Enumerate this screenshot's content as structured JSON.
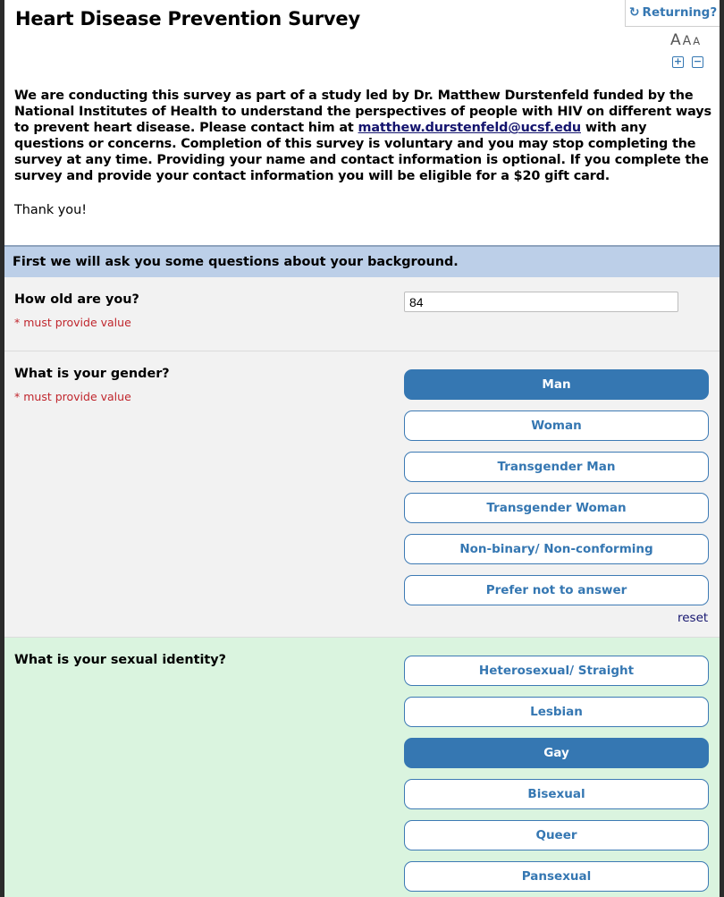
{
  "header": {
    "title": "Heart Disease Prevention Survey",
    "returning_label": "Returning?",
    "returning_icon": "refresh-icon",
    "font_size_labels": [
      "A",
      "A",
      "A"
    ],
    "zoom_in_icon": "plus-square-icon",
    "zoom_out_icon": "minus-square-icon"
  },
  "intro": {
    "text_before_link": "We are conducting this survey as part of a study led by Dr. Matthew Durstenfeld funded by the National Institutes of Health to understand the perspectives of people with HIV on different ways to prevent heart disease. Please contact him at ",
    "email_link": "matthew.durstenfeld@ucsf.edu",
    "text_after_link": " with any questions or concerns. Completion of this survey is voluntary and you may stop completing the survey at any time. Providing your name and contact information is optional. If you complete the survey and provide your contact information you will be eligible for a $20 gift card.",
    "thanks": "Thank you!"
  },
  "section": {
    "header": "First we will ask you some questions about your background."
  },
  "questions": {
    "age": {
      "label": "How old are you?",
      "required_note": "* must provide value",
      "value": "84"
    },
    "gender": {
      "label": "What is your gender?",
      "required_note": "* must provide value",
      "options": [
        {
          "label": "Man",
          "selected": true
        },
        {
          "label": "Woman",
          "selected": false
        },
        {
          "label": "Transgender Man",
          "selected": false
        },
        {
          "label": "Transgender Woman",
          "selected": false
        },
        {
          "label": "Non-binary/ Non-conforming",
          "selected": false
        },
        {
          "label": "Prefer not to answer",
          "selected": false
        }
      ],
      "reset_label": "reset"
    },
    "sexual_identity": {
      "label": "What is your sexual identity?",
      "options": [
        {
          "label": "Heterosexual/ Straight",
          "selected": false
        },
        {
          "label": "Lesbian",
          "selected": false
        },
        {
          "label": "Gay",
          "selected": true
        },
        {
          "label": "Bisexual",
          "selected": false
        },
        {
          "label": "Queer",
          "selected": false
        },
        {
          "label": "Pansexual",
          "selected": false
        }
      ]
    }
  },
  "colors": {
    "accent": "#3577b2",
    "section_header_bg": "#bccfe8",
    "question_bg": "#f2f2f2",
    "highlight_bg": "#daf4df",
    "required_text": "#c0262d",
    "link": "#14146e"
  }
}
